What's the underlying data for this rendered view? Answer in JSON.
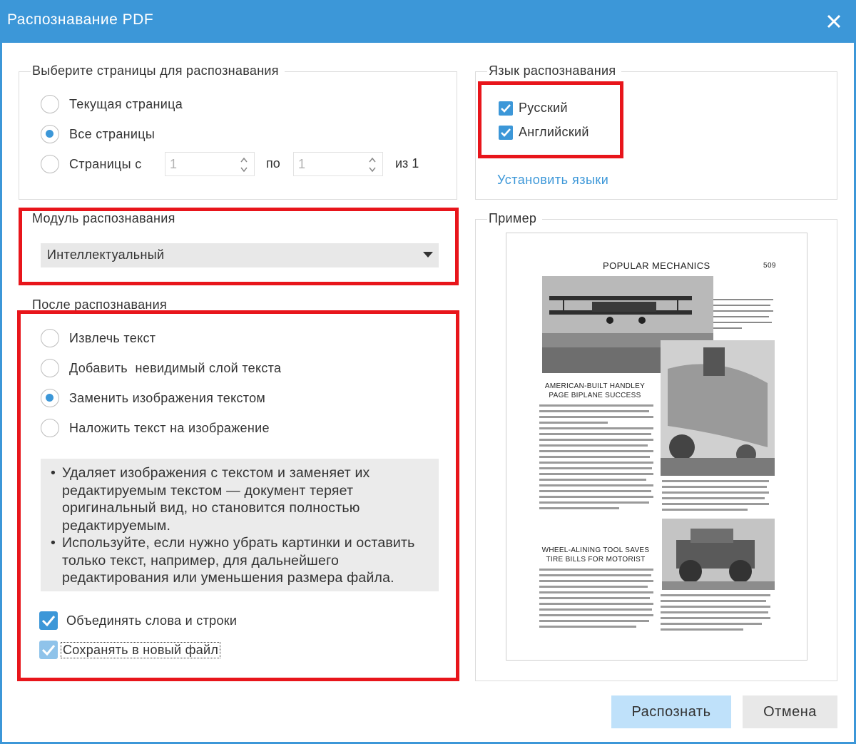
{
  "window": {
    "title": "Распознавание PDF"
  },
  "pages_group": {
    "legend": "Выберите страницы для распознавания",
    "options": [
      {
        "label": "Текущая страница",
        "checked": false
      },
      {
        "label": "Все страницы",
        "checked": true
      },
      {
        "label": "Страницы с",
        "checked": false
      }
    ],
    "from_value": "1",
    "to_label": "по",
    "to_value": "1",
    "of_label": "из 1"
  },
  "module_group": {
    "legend": "Модуль распознавания",
    "selected": "Интеллектуальный"
  },
  "after_group": {
    "legend": "После распознавания",
    "options": [
      {
        "label": "Извлечь текст",
        "checked": false
      },
      {
        "label": "Добавить  невидимый слой текста",
        "checked": false
      },
      {
        "label": "Заменить изображения текстом",
        "checked": true
      },
      {
        "label": "Наложить текст на изображение",
        "checked": false
      }
    ],
    "description": [
      "Удаляет изображения с текстом и заменяет их редактируемым текстом — документ теряет оригинальный вид, но становится полностью редактируемым.",
      "Используйте, если нужно убрать картинки и оставить только текст, например, для дальнейшего редактирования или уменьшения размера файла."
    ],
    "checkboxes": [
      {
        "label": "Объединять слова и строки",
        "checked": true
      },
      {
        "label": "Сохранять в новый файл",
        "checked": true
      }
    ]
  },
  "language_group": {
    "legend": "Язык распознавания",
    "languages": [
      {
        "label": "Русский",
        "checked": true
      },
      {
        "label": "Английский",
        "checked": true
      }
    ],
    "install_link": "Установить языки"
  },
  "preview_group": {
    "legend": "Пример",
    "doc": {
      "header": "POPULAR  MECHANICS",
      "page_number": "509",
      "headline1": "AMERICAN-BUILT HANDLEY\nPAGE BIPLANE SUCCESS",
      "headline2": "WHEEL-ALINING TOOL SAVES\nTIRE BILLS FOR MOTORIST"
    }
  },
  "buttons": {
    "recognize": "Распознать",
    "cancel": "Отмена"
  },
  "colors": {
    "accent": "#3c97d8",
    "highlight": "#e8151b",
    "primary_button": "#bfe1fa"
  }
}
